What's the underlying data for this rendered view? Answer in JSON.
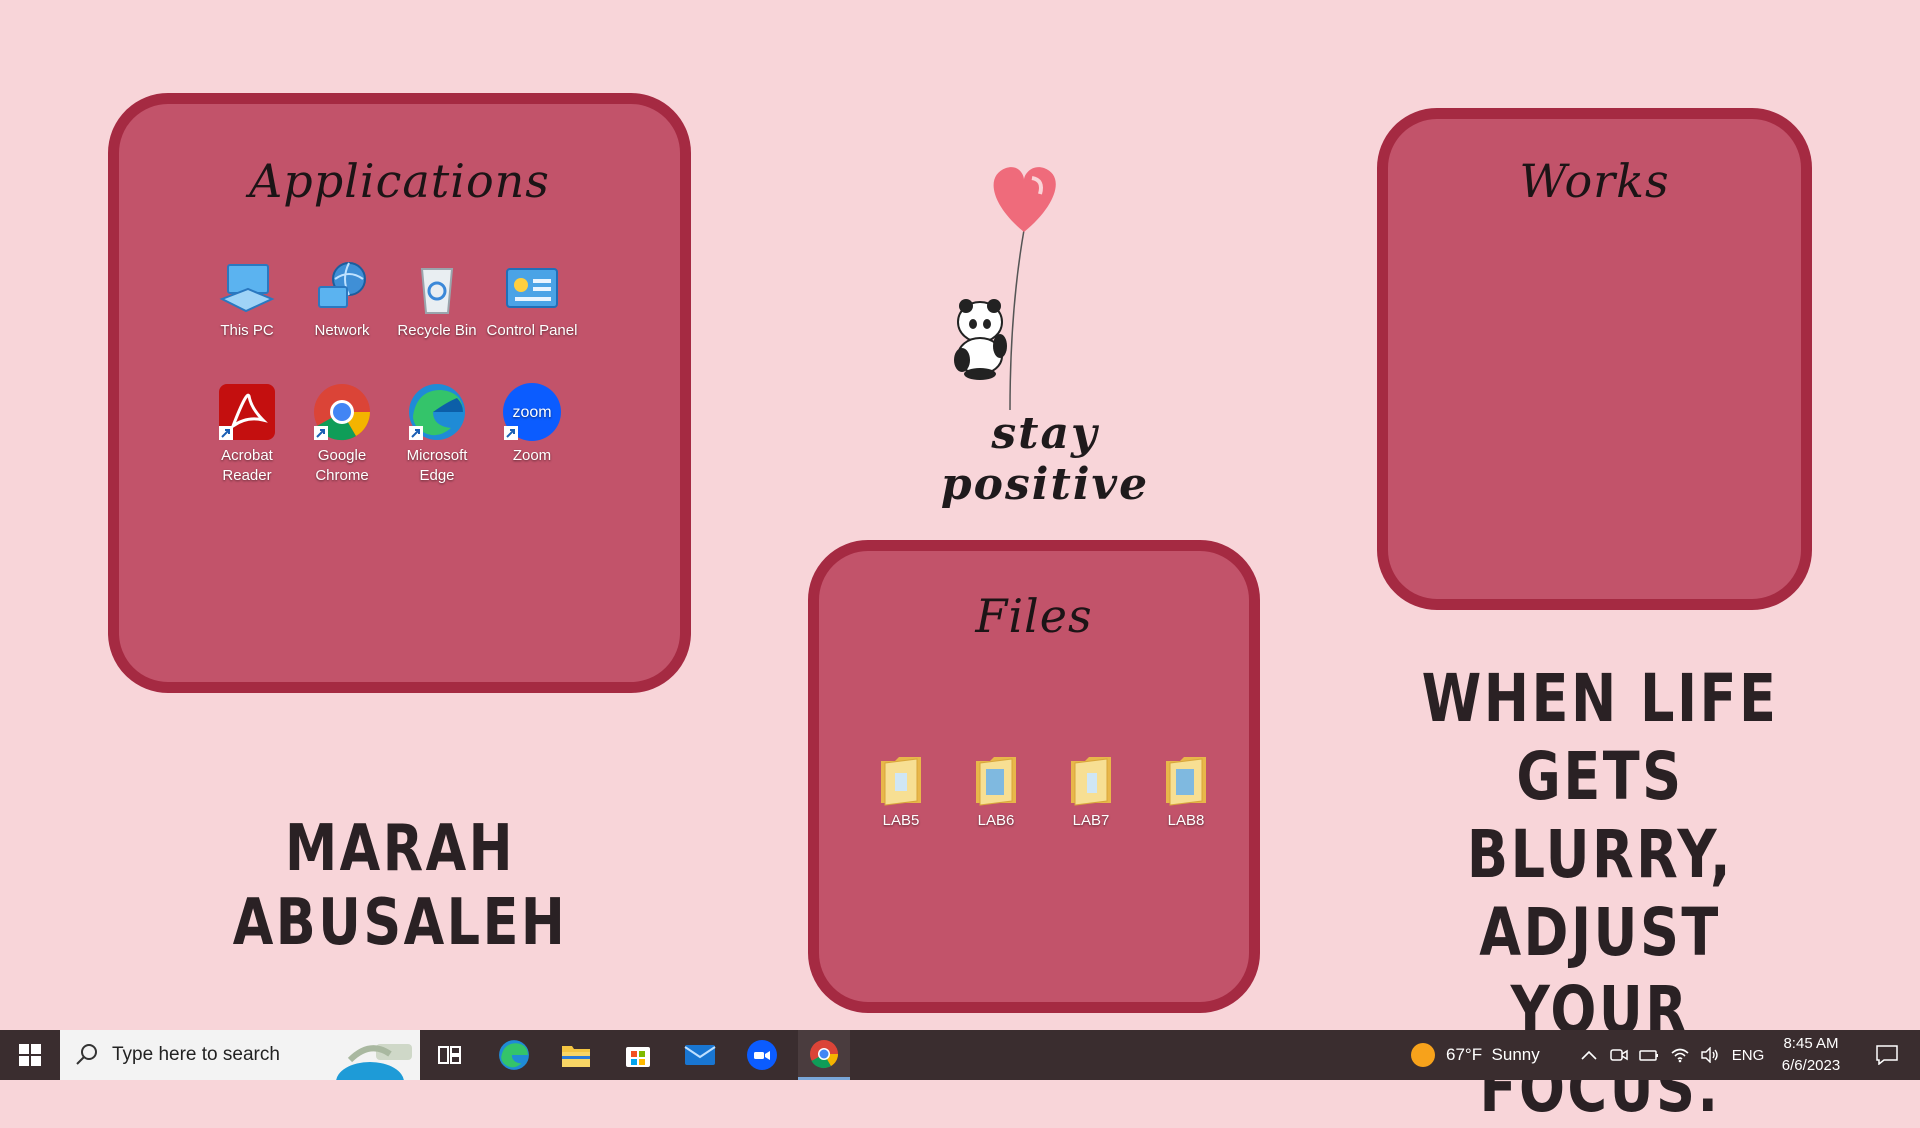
{
  "wallpaper": {
    "owner_name": "MARAH ABUSALEH",
    "quote_lines": [
      "WHEN LIFE",
      "GETS BLURRY,",
      "ADJUST YOUR",
      "FOCUS."
    ],
    "center_slogan": "stay positive",
    "colors": {
      "background": "#f8d5d9",
      "panel": "#c2536a",
      "panel_border": "#a52a42"
    }
  },
  "panels": {
    "applications": {
      "title": "Applications"
    },
    "works": {
      "title": "Works"
    },
    "files": {
      "title": "Files"
    }
  },
  "desktop_icons": {
    "this_pc": "This PC",
    "network": "Network",
    "recycle_bin": "Recycle Bin",
    "control_panel": "Control Panel",
    "acrobat_1": "Acrobat",
    "acrobat_2": "Reader",
    "chrome_1": "Google",
    "chrome_2": "Chrome",
    "edge_1": "Microsoft",
    "edge_2": "Edge",
    "zoom": "Zoom",
    "zoom_logo": "zoom"
  },
  "folders": [
    "LAB5",
    "LAB6",
    "LAB7",
    "LAB8"
  ],
  "taskbar": {
    "search_placeholder": "Type here to search",
    "pinned": [
      "Task View",
      "Microsoft Edge",
      "File Explorer",
      "Microsoft Store",
      "Mail",
      "Zoom",
      "Google Chrome"
    ],
    "weather": "67°F  Sunny",
    "language": "ENG",
    "time": "8:45 AM",
    "date": "6/6/2023"
  }
}
